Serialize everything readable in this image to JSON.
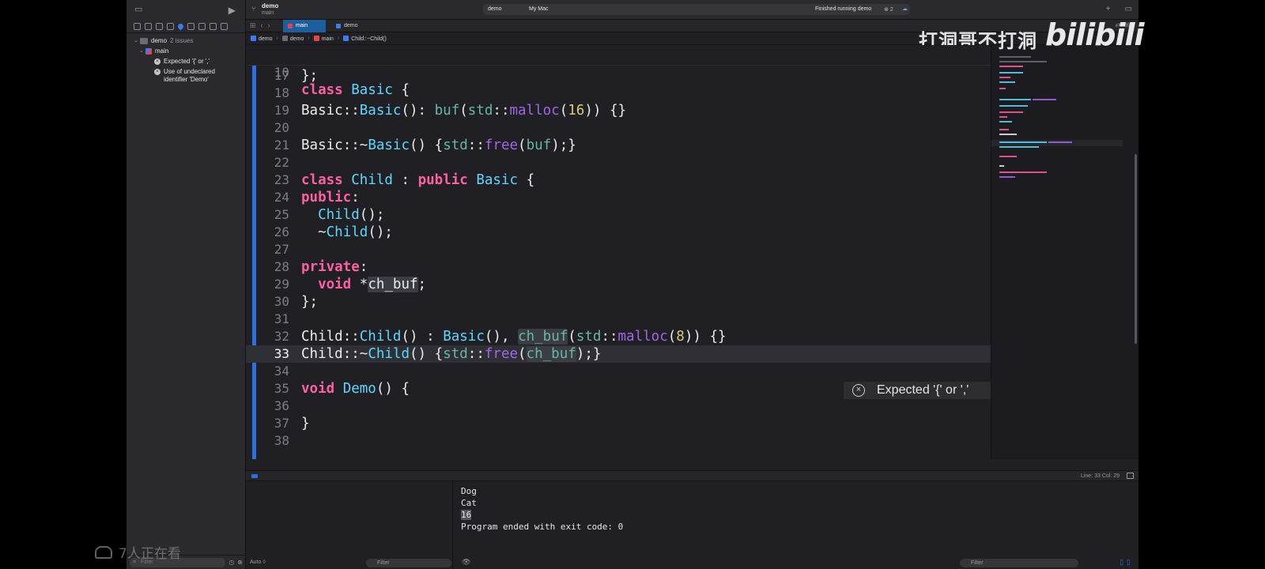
{
  "toolbar": {
    "scheme_name": "demo",
    "scheme_branch": "main",
    "run_target": "demo",
    "run_destination": "My Mac",
    "status": "Finished running demo",
    "issue_count": "2"
  },
  "navigator": {
    "project": "demo",
    "project_issue_summary": "2 issues",
    "file": "main",
    "issues": [
      "Expected '{' or ','",
      "Use of undeclared identifier 'Demo'"
    ],
    "filter_placeholder": "Filter"
  },
  "tabs": [
    "main",
    "demo"
  ],
  "breadcrumb": [
    "demo",
    "demo",
    "main",
    "Child::~Child()"
  ],
  "editor": {
    "sticky_line": {
      "num": "10",
      "text": "class Basic {"
    },
    "lines": [
      {
        "num": "17",
        "text": "};"
      },
      {
        "num": "18",
        "text": ""
      },
      {
        "num": "19",
        "text": "Basic::Basic(): buf(std::malloc(16)) {}"
      },
      {
        "num": "20",
        "text": ""
      },
      {
        "num": "21",
        "text": "Basic::~Basic() {std::free(buf);}"
      },
      {
        "num": "22",
        "text": ""
      },
      {
        "num": "23",
        "text": "class Child : public Basic {"
      },
      {
        "num": "24",
        "text": "public:"
      },
      {
        "num": "25",
        "text": "  Child();"
      },
      {
        "num": "26",
        "text": "  ~Child();"
      },
      {
        "num": "27",
        "text": ""
      },
      {
        "num": "28",
        "text": "private:"
      },
      {
        "num": "29",
        "text": "  void *ch_buf;"
      },
      {
        "num": "30",
        "text": "};"
      },
      {
        "num": "31",
        "text": ""
      },
      {
        "num": "32",
        "text": "Child::Child() : Basic(), ch_buf(std::malloc(8)) {}"
      },
      {
        "num": "33",
        "text": "Child::~Child() {std::free(ch_buf);}"
      },
      {
        "num": "34",
        "text": ""
      },
      {
        "num": "35",
        "text": "void Demo() {"
      },
      {
        "num": "36",
        "text": ""
      },
      {
        "num": "37",
        "text": "}"
      },
      {
        "num": "38",
        "text": ""
      }
    ],
    "current_line": "33",
    "inline_error": "Expected '{' or ','"
  },
  "status_line": "Line: 33  Col: 29",
  "console": {
    "output": [
      "Dog",
      "Cat",
      "16",
      "Program ended with exit code: 0"
    ]
  },
  "debug_bar": {
    "variables_scope": "Auto ◊",
    "filter_placeholder": "Filter"
  },
  "overlay": {
    "uploader": "打洞哥不打洞",
    "site_logo": "bilibili",
    "viewers": "7人正在看"
  },
  "colors": {
    "accent": "#2d6fe0",
    "keyword": "#fc5fa3",
    "type": "#5dd8ff",
    "function": "#a167e6",
    "number": "#d9c97c"
  }
}
